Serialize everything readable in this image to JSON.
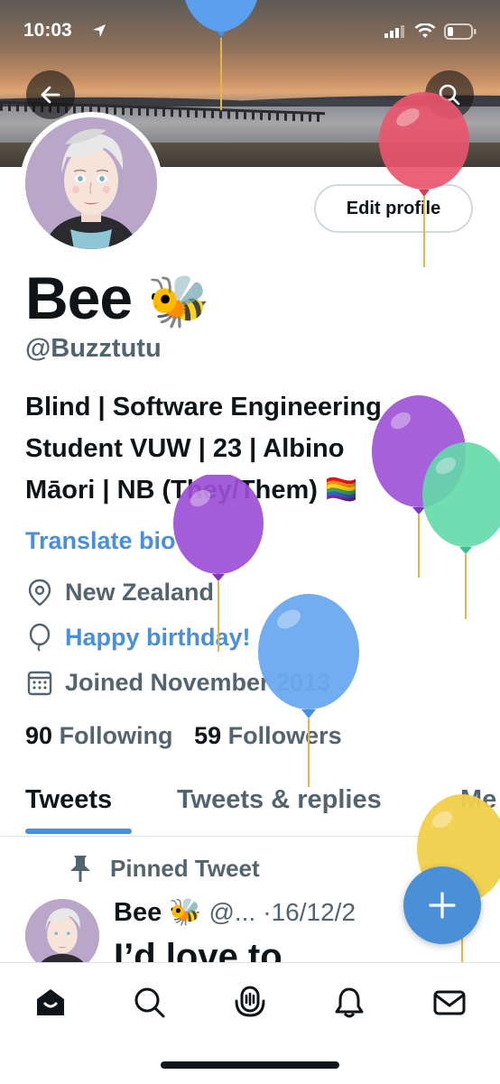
{
  "status_bar": {
    "time": "10:03"
  },
  "header": {
    "back_icon": "arrow-left-icon",
    "search_icon": "search-icon"
  },
  "profile": {
    "name": "Bee",
    "name_emoji": "🐝",
    "handle": "@Buzztutu",
    "edit_button_label": "Edit profile",
    "bio_lines": [
      "Blind | Software Engineering",
      "Student VUW | 23 | Albino",
      "Māori | NB (They/Them) 🏳️‍🌈"
    ],
    "translate_label": "Translate bio",
    "location": "New Zealand",
    "birthday": "Happy birthday!",
    "joined": "Joined November 2013",
    "following_count": "90",
    "following_label": "Following",
    "followers_count": "59",
    "followers_label": "Followers"
  },
  "tabs": [
    {
      "label": "Tweets",
      "active": true
    },
    {
      "label": "Tweets & replies",
      "active": false
    },
    {
      "label": "Me",
      "active": false
    }
  ],
  "pinned_tweet": {
    "pinned_label": "Pinned Tweet",
    "author": "Bee 🐝",
    "handle": "@...",
    "date": "·16/12/2",
    "text": "I’d love to"
  },
  "bottom_nav": [
    {
      "name": "home",
      "icon": "home-icon"
    },
    {
      "name": "search",
      "icon": "search-icon"
    },
    {
      "name": "spaces",
      "icon": "spaces-icon"
    },
    {
      "name": "notifications",
      "icon": "bell-icon"
    },
    {
      "name": "messages",
      "icon": "mail-icon"
    }
  ],
  "colors": {
    "accent": "#4a90d9",
    "text_primary": "#0f1419",
    "text_secondary": "#536471"
  }
}
